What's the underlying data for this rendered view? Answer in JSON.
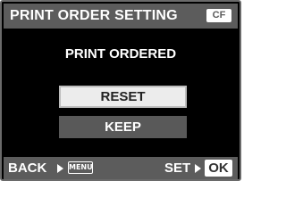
{
  "header": {
    "title": "PRINT ORDER SETTING",
    "card_badge": "CF"
  },
  "subtitle": "PRINT ORDERED",
  "options": [
    {
      "label": "RESET",
      "selected": true
    },
    {
      "label": "KEEP",
      "selected": false
    }
  ],
  "footer": {
    "back_label": "BACK",
    "back_icon": "right-arrow-icon",
    "menu_key_label": "MENU",
    "set_label": "SET",
    "set_icon": "right-arrow-icon",
    "ok_key_label": "OK"
  },
  "colors": {
    "background": "#000000",
    "bar": "#5c5c5c",
    "selected_option": "#ececec",
    "unselected_option": "#595959"
  }
}
